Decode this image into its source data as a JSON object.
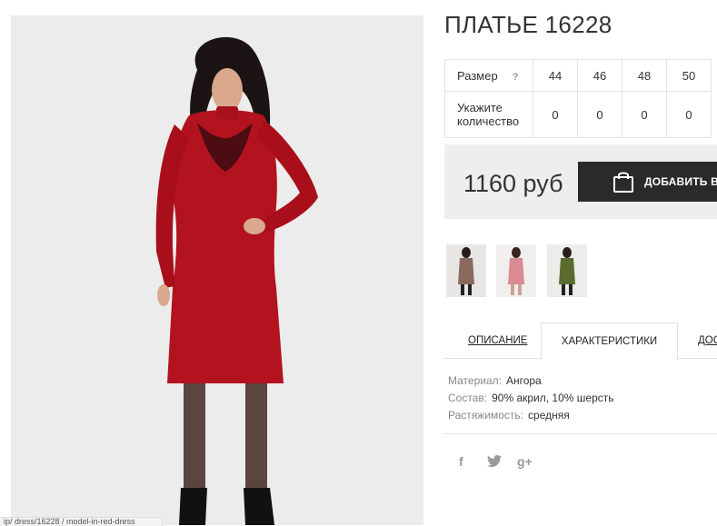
{
  "product": {
    "title": "ПЛАТЬЕ 16228"
  },
  "size_table": {
    "size_label": "Размер",
    "help_mark": "?",
    "sizes": [
      "44",
      "46",
      "48",
      "50"
    ],
    "qty_label": "Укажите количество",
    "quantities": [
      "0",
      "0",
      "0",
      "0"
    ]
  },
  "buy": {
    "price": "1160 руб",
    "add_label": "ДОБАВИТЬ В З",
    "add_icon": "shopping-bag-icon"
  },
  "thumbnails": [
    {
      "name": "dress-thumb-brown",
      "color": "#8a6a5e"
    },
    {
      "name": "dress-thumb-pink",
      "color": "#d98a93"
    },
    {
      "name": "dress-thumb-green",
      "color": "#5a6b2e"
    }
  ],
  "tabs": [
    {
      "label": "ОПИСАНИЕ",
      "active": false
    },
    {
      "label": "ХАРАКТЕРИСТИКИ",
      "active": true
    },
    {
      "label": "ДОС",
      "active": false
    }
  ],
  "specs": [
    {
      "key": "Материал:",
      "value": "Ангора"
    },
    {
      "key": "Состав:",
      "value": "90% акрил, 10% шерсть"
    },
    {
      "key": "Растяжимость:",
      "value": "средняя"
    }
  ],
  "social": {
    "facebook": "f",
    "twitter": "twitter-icon",
    "googleplus": "g+"
  },
  "colors": {
    "dress": "#b3121f",
    "button": "#2a2a2a",
    "panel": "#eeeeee"
  }
}
